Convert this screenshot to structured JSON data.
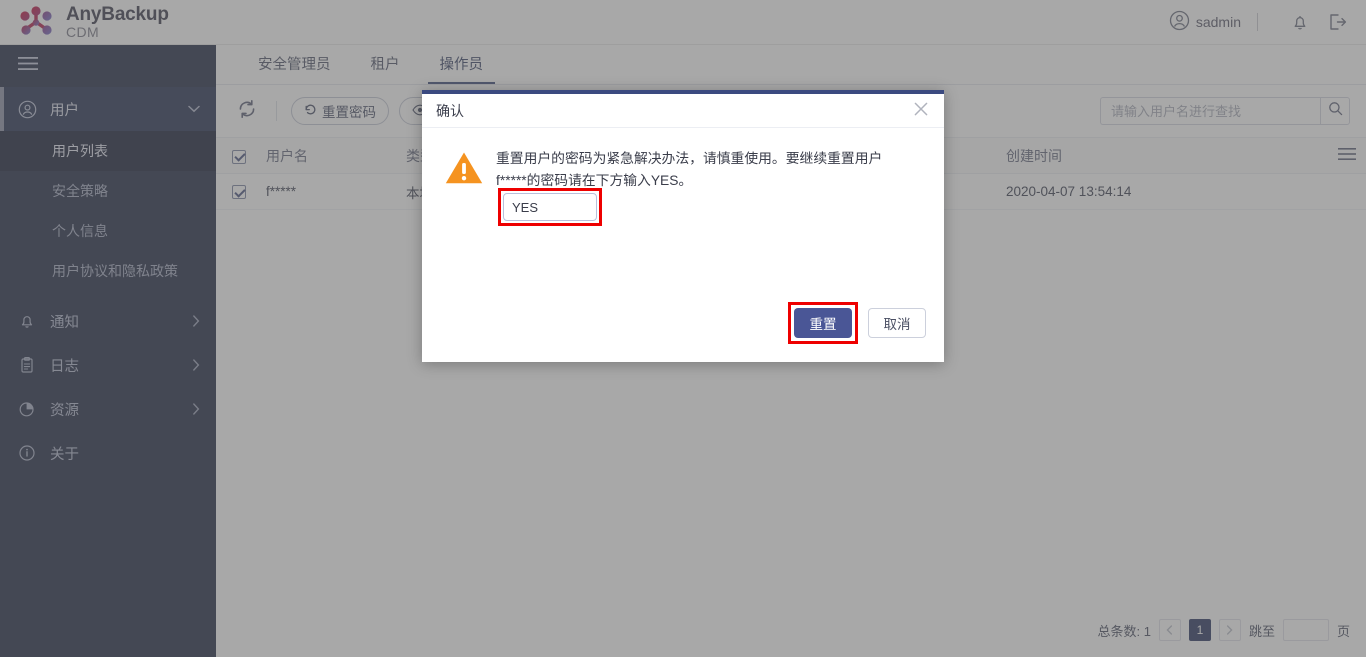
{
  "app": {
    "brand_title": "AnyBackup",
    "brand_sub": "CDM",
    "accent_navy": "#222b45",
    "accent_blue": "#4a5696",
    "warning_orange": "#f59320",
    "highlight_red": "#ee0000"
  },
  "topbar": {
    "user_name": "sadmin",
    "user_icon": "user-circle-icon",
    "notification_icon": "bell-icon",
    "logout_icon": "logout-icon",
    "divider": "|"
  },
  "sidebar": {
    "menu_icon": "hamburger-icon",
    "items": [
      {
        "label": "用户",
        "icon": "user-circle-icon",
        "arrow": "chevron-down-icon",
        "expanded": true,
        "children": [
          {
            "label": "用户列表",
            "active": true
          },
          {
            "label": "安全策略",
            "active": false
          },
          {
            "label": "个人信息",
            "active": false
          },
          {
            "label": "用户协议和隐私政策",
            "active": false
          }
        ]
      },
      {
        "label": "通知",
        "icon": "bell-icon",
        "arrow": "chevron-right-icon",
        "expanded": false
      },
      {
        "label": "日志",
        "icon": "clipboard-icon",
        "arrow": "chevron-right-icon",
        "expanded": false
      },
      {
        "label": "资源",
        "icon": "pie-chart-icon",
        "arrow": "chevron-right-icon",
        "expanded": false
      },
      {
        "label": "关于",
        "icon": "info-circle-icon",
        "arrow": "",
        "expanded": false
      }
    ]
  },
  "tabs": [
    {
      "label": "安全管理员",
      "active": false
    },
    {
      "label": "租户",
      "active": false
    },
    {
      "label": "操作员",
      "active": true
    }
  ],
  "toolbar": {
    "refresh_icon": "refresh-icon",
    "reset_password_label": "重置密码",
    "reset_password_icon": "undo-icon",
    "view_icon": "eye-icon",
    "view_label": ""
  },
  "search": {
    "placeholder": "请输入用户名进行查找",
    "value": "",
    "icon": "search-icon"
  },
  "table": {
    "columns": [
      "用户名",
      "类型",
      "创建时间"
    ],
    "menu_icon": "list-menu-icon",
    "rows": [
      {
        "checked": true,
        "username": "f*****",
        "type": "本地用户",
        "created": "2020-04-07 13:54:14"
      }
    ],
    "header_checked": true
  },
  "pagination": {
    "total_label": "总条数: 1",
    "prev_icon": "chevron-left-icon",
    "next_icon": "chevron-right-icon",
    "current_page": "1",
    "jump_label": "跳至",
    "jump_value": "",
    "page_unit": "页"
  },
  "dialog": {
    "title": "确认",
    "close_icon": "close-icon",
    "warning_icon": "warning-triangle-icon",
    "message": "重置用户的密码为紧急解决办法，请慎重使用。要继续重置用户 f*****的密码请在下方输入YES。",
    "confirm_input_value": "YES",
    "confirm_input_placeholder": "",
    "primary_label": "重置",
    "cancel_label": "取消"
  }
}
